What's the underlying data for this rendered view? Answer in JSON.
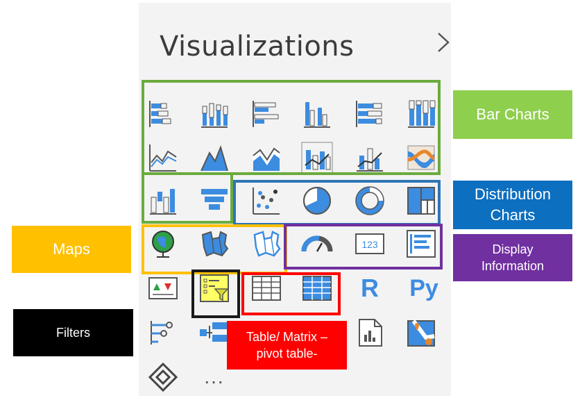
{
  "panel": {
    "title": "Visualizations"
  },
  "labels": {
    "bar": "Bar Charts",
    "distribution": "Distribution Charts",
    "maps": "Maps",
    "display": "Display Information",
    "filters": "Filters",
    "table": "Table/ Matrix – pivot table-"
  },
  "icons": {
    "r": "R",
    "py": "Py",
    "more": "...",
    "card": "123"
  },
  "colors": {
    "bar": "#8fcf4e",
    "bar_frame": "#6aab3d",
    "distribution": "#0d6fbf",
    "distribution_frame": "#2e75b6",
    "maps": "#ffc000",
    "display": "#7030a0",
    "filters": "#000000",
    "table": "#ff0000",
    "icon_blue": "#3c8ce0",
    "icon_gray": "#5a5a5a"
  }
}
